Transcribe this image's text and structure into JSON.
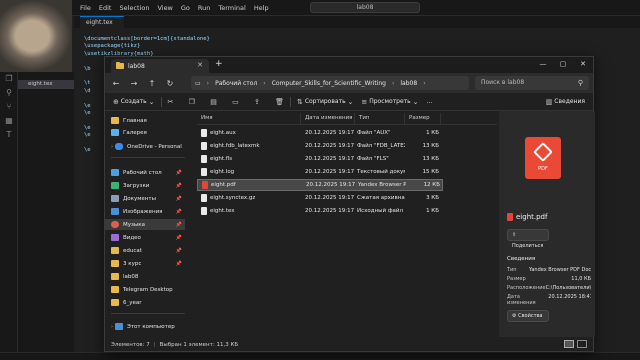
{
  "editor": {
    "menu": [
      "File",
      "Edit",
      "Selection",
      "View",
      "Go",
      "Run",
      "Terminal",
      "Help"
    ],
    "title": "lab08",
    "tab": "eight.tex",
    "explorer_file": "eight.tex",
    "code_lines": [
      "\\documentclass[border=1cm]{standalone}",
      "\\usepackage{tikz}",
      "\\usetikzlibrary{math}",
      "",
      "\\b",
      "",
      "\\t",
      "\\d",
      "",
      "\\e",
      "\\e",
      "",
      "\\e",
      "\\e",
      "",
      "\\e"
    ]
  },
  "explorer": {
    "tab_title": "lab08",
    "breadcrumb": [
      "Рабочий стол",
      "Computer_Skills_for_Scientific_Writing",
      "lab08"
    ],
    "search_placeholder": "Поиск в lab08",
    "toolbar": {
      "create": "Создать",
      "sort": "Сортировать",
      "view": "Просмотреть",
      "more": "...",
      "details": "Сведения"
    },
    "nav": {
      "items": [
        {
          "label": "Главная",
          "color": "#e8b84a",
          "pinned": false
        },
        {
          "label": "Галерея",
          "color": "#5ab0e8",
          "pinned": false
        },
        {
          "label": "OneDrive - Personal",
          "color": "#3a8ee6",
          "pinned": false
        },
        {
          "label": "Рабочий стол",
          "color": "#4aa0e0",
          "pinned": true
        },
        {
          "label": "Загрузки",
          "color": "#3cb371",
          "pinned": true
        },
        {
          "label": "Документы",
          "color": "#8a9db5",
          "pinned": true
        },
        {
          "label": "Изображения",
          "color": "#4a90d9",
          "pinned": true
        },
        {
          "label": "Музыка",
          "color": "#e06050",
          "pinned": true
        },
        {
          "label": "Видео",
          "color": "#9b6bd6",
          "pinned": true
        },
        {
          "label": "educat",
          "color": "#e8b84a",
          "pinned": true
        },
        {
          "label": "3 курс",
          "color": "#e8b84a",
          "pinned": true
        },
        {
          "label": "lab08",
          "color": "#e8b84a",
          "pinned": false
        },
        {
          "label": "Telegram Desktop",
          "color": "#e8b84a",
          "pinned": false
        },
        {
          "label": "6_year",
          "color": "#e8b84a",
          "pinned": false
        },
        {
          "label": "Этот компьютер",
          "color": "#4a90d9",
          "pinned": false
        }
      ]
    },
    "columns": [
      "Имя",
      "Дата изменения",
      "Тип",
      "Размер"
    ],
    "files": [
      {
        "name": "eight.aux",
        "date": "20.12.2025 19:17",
        "type": "Файл \"AUX\"",
        "size": "1 КБ",
        "pdf": false
      },
      {
        "name": "eight.fdb_latexmk",
        "date": "20.12.2025 19:17",
        "type": "Файл \"FDB_LATEX...",
        "size": "13 КБ",
        "pdf": false
      },
      {
        "name": "eight.fls",
        "date": "20.12.2025 19:17",
        "type": "Файл \"FLS\"",
        "size": "13 КБ",
        "pdf": false
      },
      {
        "name": "eight.log",
        "date": "20.12.2025 19:17",
        "type": "Текстовый докум...",
        "size": "15 КБ",
        "pdf": false
      },
      {
        "name": "eight.pdf",
        "date": "20.12.2025 19:17",
        "type": "Yandex Browser P...",
        "size": "12 КБ",
        "pdf": true
      },
      {
        "name": "eight.synctex.gz",
        "date": "20.12.2025 19:17",
        "type": "Сжатая архивная ...",
        "size": "3 КБ",
        "pdf": false
      },
      {
        "name": "eight.tex",
        "date": "20.12.2025 19:17",
        "type": "Исходный файл L...",
        "size": "1 КБ",
        "pdf": false
      }
    ],
    "details": {
      "icon_label": "PDF",
      "file_name": "eight.pdf",
      "share": "Поделиться",
      "section": "Сведения",
      "rows": [
        {
          "key": "Тип",
          "value": "Yandex Browser PDF Docum..."
        },
        {
          "key": "Размер",
          "value": "11,0 КБ"
        },
        {
          "key": "Расположение",
          "value": "C:\\Пользователи\\anastasia..."
        },
        {
          "key": "Дата изменения",
          "value": "20.12.2025 18:41"
        }
      ],
      "properties": "Свойства"
    },
    "status": {
      "count": "Элементов: 7",
      "selected": "Выбран 1 элемент: 11,3 КБ"
    }
  }
}
